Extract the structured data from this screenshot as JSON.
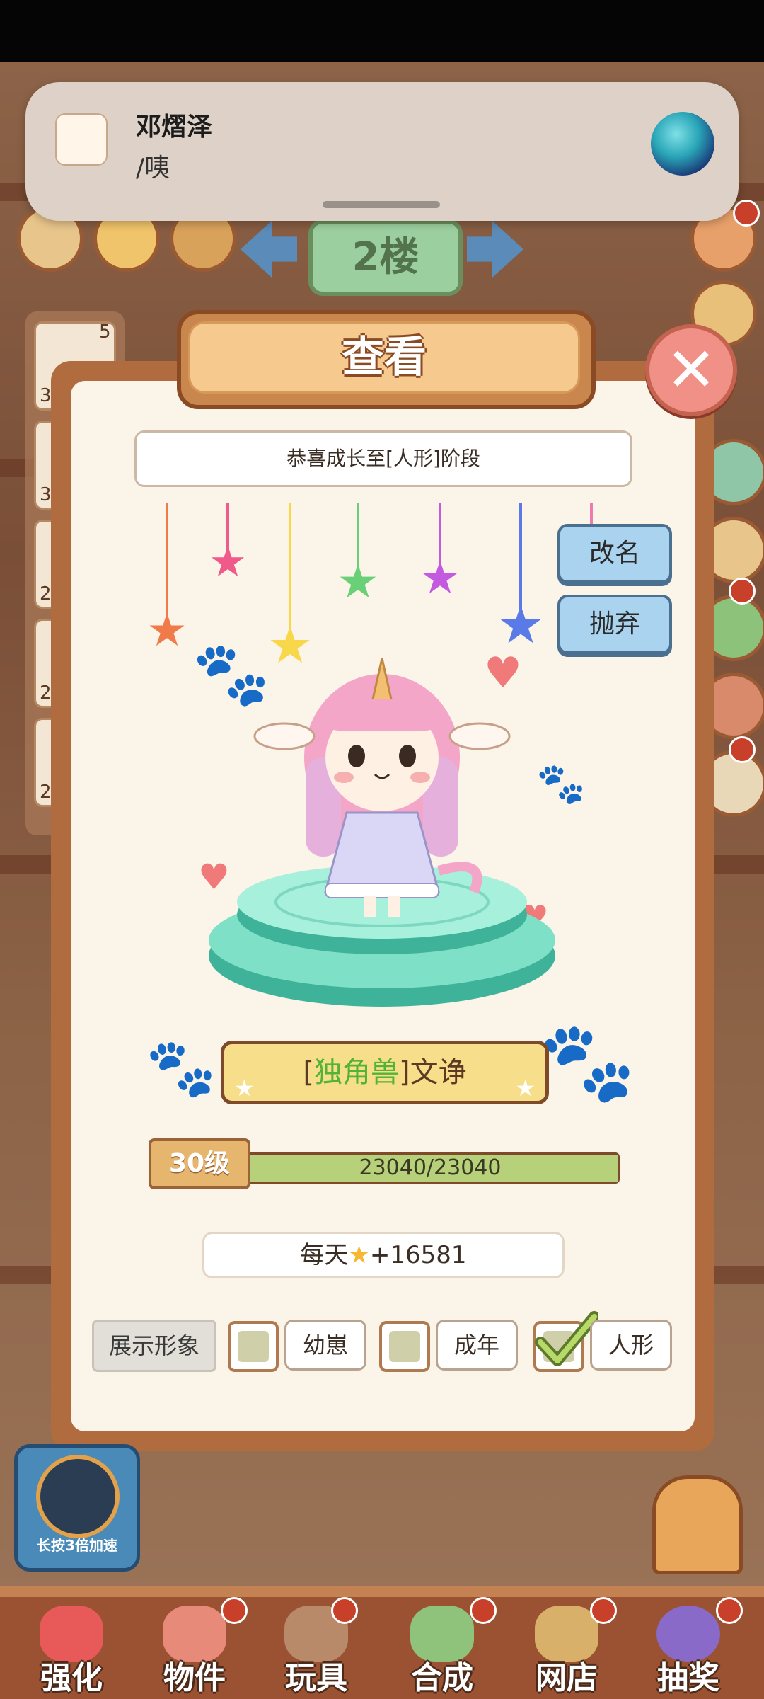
{
  "notification": {
    "sender": "邓熠泽",
    "message": "/咦"
  },
  "hud": {
    "floor": "2楼"
  },
  "left_list": {
    "badge": "5",
    "counts": [
      "3",
      "3",
      "2",
      "2",
      "2"
    ]
  },
  "dialog": {
    "title": "查看",
    "banner": "恭喜成长至[人形]阶段",
    "rename_label": "改名",
    "abandon_label": "抛弃",
    "species": "独角兽",
    "pet_name": "文诤",
    "level_label": "30级",
    "xp_text": "23040/23040",
    "xp_progress": 1.0,
    "daily_prefix": "每天",
    "daily_value": "+16581",
    "display_label": "展示形象",
    "stages": [
      {
        "label": "幼崽",
        "checked": false
      },
      {
        "label": "成年",
        "checked": false
      },
      {
        "label": "人形",
        "checked": true
      }
    ]
  },
  "speed_button_label": "长按3倍加速",
  "bottom_nav": [
    {
      "label": "强化",
      "color": "#e85a5a"
    },
    {
      "label": "物件",
      "color": "#e88a7a"
    },
    {
      "label": "玩具",
      "color": "#b98a6a"
    },
    {
      "label": "合成",
      "color": "#8fc27a"
    },
    {
      "label": "网店",
      "color": "#d8b06a"
    },
    {
      "label": "抽奖",
      "color": "#8a6ac8"
    }
  ],
  "colors": {
    "accent_green": "#53b339",
    "dialog_frame": "#b06b3e",
    "button_blue": "#a9d3ef"
  }
}
